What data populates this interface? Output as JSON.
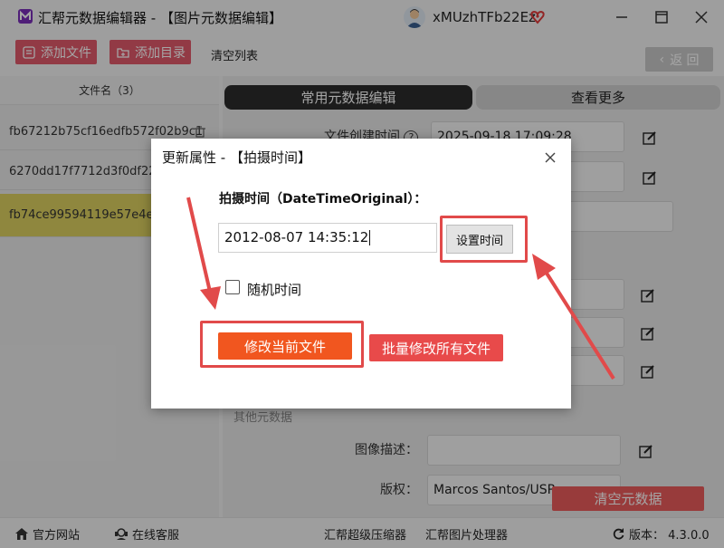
{
  "app": {
    "title": "汇帮元数据编辑器 - 【图片元数据编辑】",
    "user": "xMUzhTFb22Ez"
  },
  "toolbar": {
    "add_file": "添加文件",
    "add_dir": "添加目录",
    "clear_list": "清空列表",
    "back": "返 回"
  },
  "filelist": {
    "header": "文件名（3）",
    "rows": [
      "fb67212b75cf16edfb572f02b9c1",
      "6270dd17f7712d3f0df225",
      "fb74ce99594119e57e4eb"
    ]
  },
  "tabs": {
    "common": "常用元数据编辑",
    "more": "查看更多"
  },
  "fields": {
    "created_label": "文件创建时间",
    "created_value": "2025-09-18 17:09:28",
    "section_other": "其他元数据",
    "desc_label": "图像描述：",
    "desc_value": "",
    "copyright_label": "版权：",
    "copyright_value": "Marcos Santos/USP",
    "clear_meta": "清空元数据"
  },
  "statusbar": {
    "website": "官方网站",
    "support": "在线客服",
    "compressor": "汇帮超级压缩器",
    "image_processor": "汇帮图片处理器",
    "version": "版本：  4.3.0.0"
  },
  "dialog": {
    "title": "更新属性 - 【拍摄时间】",
    "label": "拍摄时间（DateTimeOriginal）：",
    "value": "2012-08-07 14:35:12",
    "set_time": "设置时间",
    "random_label": "随机时间",
    "random_checked": false,
    "modify_current": "修改当前文件",
    "batch_modify": "批量修改所有文件"
  },
  "colors": {
    "toolbar_btn": "#e05a6a",
    "primary": "#f1561f",
    "batch": "#e84a4a",
    "annotation": "#e14a4a",
    "selected_row": "#dcd060"
  }
}
